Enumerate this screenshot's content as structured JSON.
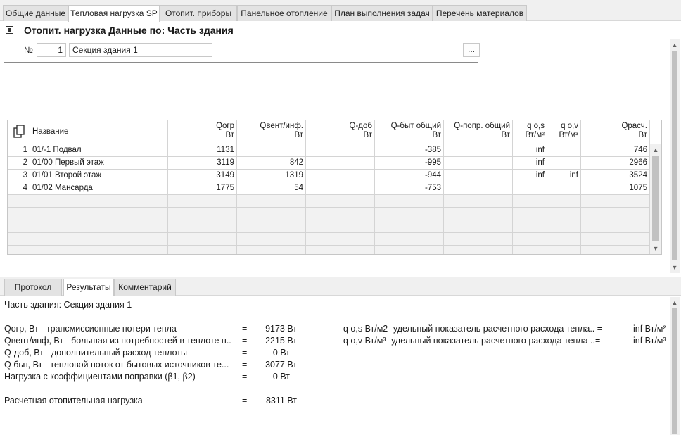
{
  "tabs": [
    "Общие данные",
    "Тепловая нагрузка SP",
    "Отопит. приборы",
    "Панельное отопление",
    "План выполнения задач",
    "Перечень материалов"
  ],
  "section": {
    "title": "Отопит. нагрузка Данные по: Часть здания",
    "number_label": "№",
    "number_value": "1",
    "name_value": "Секция здания 1",
    "browse_label": "..."
  },
  "grid": {
    "headers": [
      {
        "l1": "Название",
        "l2": ""
      },
      {
        "l1": "Qогр",
        "l2": "Вт"
      },
      {
        "l1": "Qвент/инф.",
        "l2": "Вт"
      },
      {
        "l1": "Q-доб",
        "l2": "Вт"
      },
      {
        "l1": "Q-быт общий",
        "l2": "Вт"
      },
      {
        "l1": "Q-попр. общий",
        "l2": "Вт"
      },
      {
        "l1": "q o,s",
        "l2": "Вт/м²"
      },
      {
        "l1": "q o,v",
        "l2": "Вт/м³"
      },
      {
        "l1": "Qрасч.",
        "l2": "Вт"
      }
    ],
    "rows": [
      {
        "n": "1",
        "cells": [
          "01/-1 Подвал",
          "1131",
          "",
          "",
          "-385",
          "",
          "inf",
          "",
          "746"
        ]
      },
      {
        "n": "2",
        "cells": [
          "01/00 Первый этаж",
          "3119",
          "842",
          "",
          "-995",
          "",
          "inf",
          "",
          "2966"
        ]
      },
      {
        "n": "3",
        "cells": [
          "01/01 Второй этаж",
          "3149",
          "1319",
          "",
          "-944",
          "",
          "inf",
          "inf",
          "3524"
        ]
      },
      {
        "n": "4",
        "cells": [
          "01/02 Мансарда",
          "1775",
          "54",
          "",
          "-753",
          "",
          "",
          "",
          "1075"
        ]
      }
    ],
    "empty_rows": 5
  },
  "bottom_tabs": [
    "Протокол",
    "Результаты",
    "Комментарий"
  ],
  "results": {
    "part": "Часть здания: Секция здания 1",
    "lines": [
      {
        "label": "Qогр, Вт - трансмиссионные потери тепла",
        "eq": "=",
        "value": "9173 Вт"
      },
      {
        "label": "Qвент/инф, Вт - большая из потребностей в теплоте н..",
        "eq": "=",
        "value": "2215 Вт"
      },
      {
        "label": "Q-доб, Вт - дополнительный расход теплоты",
        "eq": "=",
        "value": "0 Вт"
      },
      {
        "label": "Q быт, Вт - тепловой поток от бытовых источников те...",
        "eq": "=",
        "value": "-3077 Вт"
      },
      {
        "label": "Нагрузка с коэффициентами поправки (β1, β2)",
        "eq": "=",
        "value": "0 Вт"
      }
    ],
    "right_lines": [
      {
        "label": "q o,s Вт/м2- удельный показатель расчетного расхода тепла.. =",
        "value": "inf Вт/м²"
      },
      {
        "label": "q o,v Вт/м³- удельный показатель расчетного расхода тепла ..=",
        "value": "inf Вт/м³"
      }
    ],
    "total": {
      "label": "Расчетная отопительная нагрузка",
      "eq": "=",
      "value": "8311 Вт"
    }
  }
}
